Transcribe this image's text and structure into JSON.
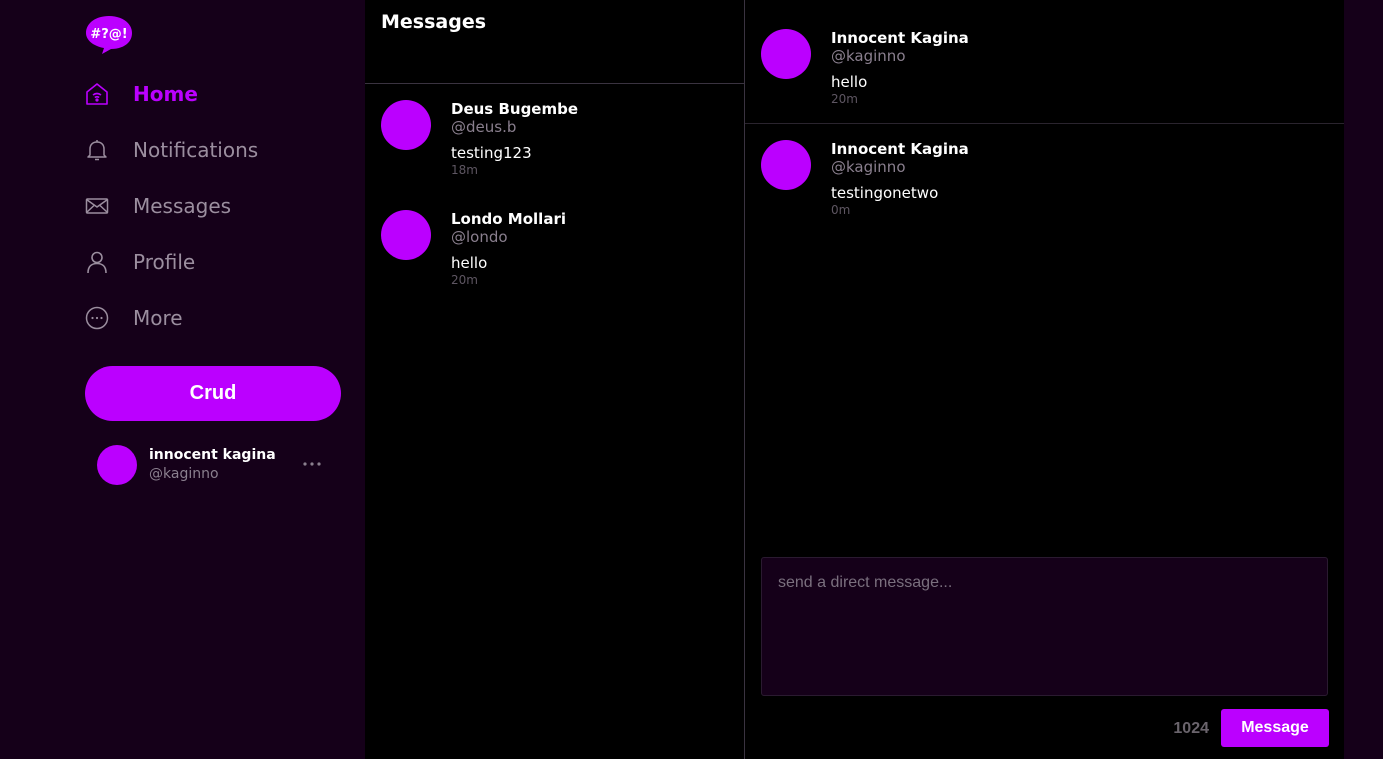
{
  "app": {
    "logo_text": "#?@!",
    "accent_color": "#bb00ff",
    "background_color": "#150019"
  },
  "sidebar": {
    "items": [
      {
        "label": "Home",
        "icon": "home-icon",
        "active": true
      },
      {
        "label": "Notifications",
        "icon": "bell-icon",
        "active": false
      },
      {
        "label": "Messages",
        "icon": "envelope-icon",
        "active": false
      },
      {
        "label": "Profile",
        "icon": "user-icon",
        "active": false
      },
      {
        "label": "More",
        "icon": "more-circle-icon",
        "active": false
      }
    ],
    "crud_button_label": "Crud",
    "current_user": {
      "name": "innocent kagina",
      "handle": "@kaginno"
    }
  },
  "messages_list": {
    "title": "Messages",
    "conversations": [
      {
        "name": "Deus Bugembe",
        "handle": "@deus.b",
        "last_message": "testing123",
        "time": "18m"
      },
      {
        "name": "Londo Mollari",
        "handle": "@londo",
        "last_message": "hello",
        "time": "20m"
      }
    ]
  },
  "thread": {
    "messages": [
      {
        "name": "Innocent Kagina",
        "handle": "@kaginno",
        "text": "hello",
        "time": "20m"
      },
      {
        "name": "Innocent Kagina",
        "handle": "@kaginno",
        "text": "testingonetwo",
        "time": "0m"
      }
    ],
    "input_placeholder": "send a direct message...",
    "char_count": "1024",
    "send_label": "Message"
  }
}
